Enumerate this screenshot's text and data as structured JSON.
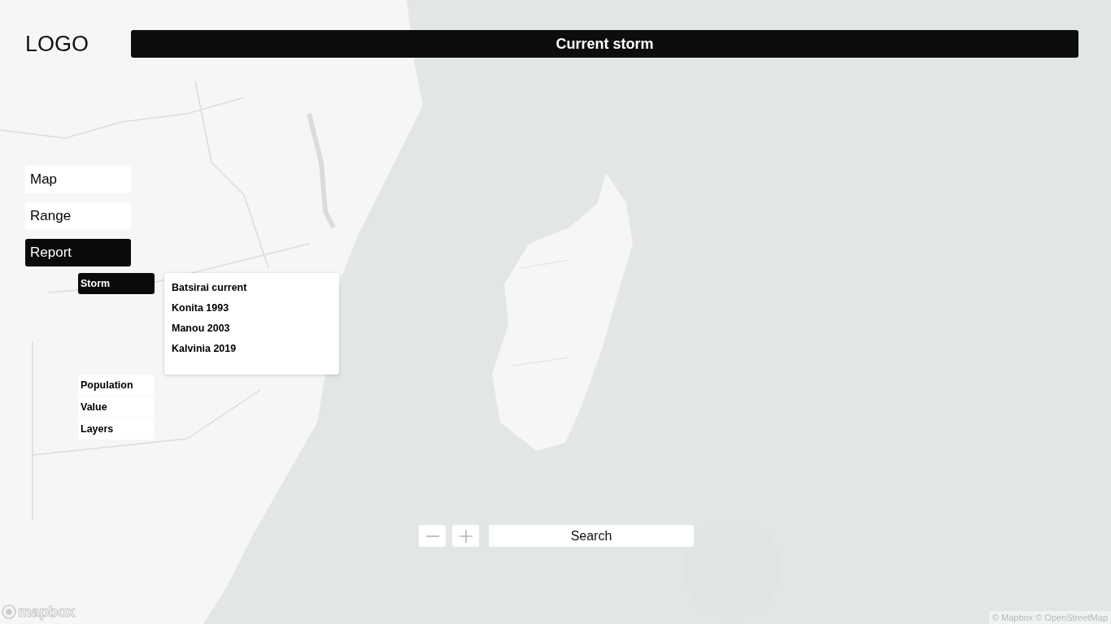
{
  "logo": "LOGO",
  "header": {
    "title": "Current storm"
  },
  "menu": [
    {
      "label": "Map",
      "selected": false
    },
    {
      "label": "Range",
      "selected": false
    },
    {
      "label": "Report",
      "selected": true
    }
  ],
  "submenu": [
    {
      "label": "Storm",
      "selected": true
    },
    {
      "label": "Population",
      "selected": false
    },
    {
      "label": "Value",
      "selected": false
    },
    {
      "label": "Layers",
      "selected": false
    }
  ],
  "storm_list": [
    {
      "label": "Batsirai current"
    },
    {
      "label": "Konita 1993"
    },
    {
      "label": "Manou 2003"
    },
    {
      "label": "Kalvinia 2019"
    }
  ],
  "search": {
    "label": "Search"
  },
  "map_logo": "mapbox",
  "attribution": "© Mapbox © OpenStreetMap"
}
